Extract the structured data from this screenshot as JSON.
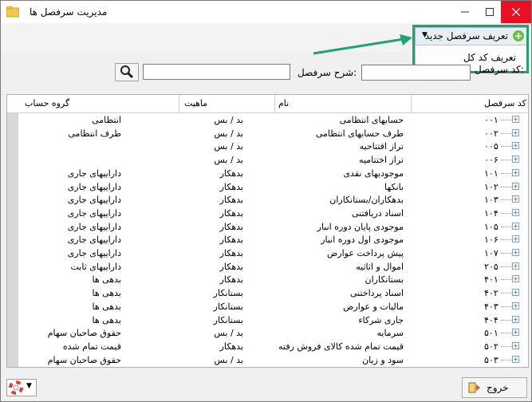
{
  "window": {
    "title": "مدیریت سرفصل ها"
  },
  "toolbar": {
    "new_header_label": "تعریف سرفصل جدید",
    "menu_item_label": "تعریف کد کل"
  },
  "filter": {
    "code_label": "کد سرفصل:",
    "desc_label": "شرح سرفصل:",
    "code_value": "",
    "desc_value": ""
  },
  "table": {
    "columns": {
      "code": "کد سرفصل",
      "name": "نام",
      "nature": "ماهیت",
      "group": "گروه حساب"
    },
    "rows": [
      {
        "code": "۰۰۱",
        "name": "حسابهای انتظامی",
        "nature": "بد / بس",
        "group": "انتظامی"
      },
      {
        "code": "۰۰۲",
        "name": "طرف حسابهای انتظامی",
        "nature": "بد / بس",
        "group": "طرف انتظامی"
      },
      {
        "code": "۰۰۵",
        "name": "تراز افتتاحیه",
        "nature": "بد / بس",
        "group": ""
      },
      {
        "code": "۰۰۶",
        "name": "تراز اختتامیه",
        "nature": "بد / بس",
        "group": ""
      },
      {
        "code": "۱۰۱",
        "name": "موجودیهای نقدی",
        "nature": "بدهکار",
        "group": "داراییهای جاری"
      },
      {
        "code": "۱۰۲",
        "name": "بانکها",
        "nature": "بدهکار",
        "group": "داراییهای جاری"
      },
      {
        "code": "۱۰۳",
        "name": "بدهکاران/بستانکاران",
        "nature": "بدهکار",
        "group": "داراییهای جاری"
      },
      {
        "code": "۱۰۴",
        "name": "اسناد دریافتنی",
        "nature": "بدهکار",
        "group": "داراییهای جاری"
      },
      {
        "code": "۱۰۵",
        "name": "موجودی پایان دوره انبار",
        "nature": "بدهکار",
        "group": "داراییهای جاری"
      },
      {
        "code": "۱۰۶",
        "name": "موجودی اول دوره انبار",
        "nature": "بدهکار",
        "group": "داراییهای جاری"
      },
      {
        "code": "۱۰۷",
        "name": "پیش پرداخت عوارض",
        "nature": "بدهکار",
        "group": "داراییهای جاری"
      },
      {
        "code": "۲۰۵",
        "name": "اموال و اثاثیه",
        "nature": "بدهکار",
        "group": "داراییهای ثابت"
      },
      {
        "code": "۴۰۱",
        "name": "بستانکاران",
        "nature": "بدهکار",
        "group": "بدهی ها"
      },
      {
        "code": "۴۰۲",
        "name": "اسناد پرداختنی",
        "nature": "بستانکار",
        "group": "بدهی ها"
      },
      {
        "code": "۴۰۳",
        "name": "مالیات و عوارض",
        "nature": "بستانکار",
        "group": "بدهی ها"
      },
      {
        "code": "۴۰۴",
        "name": "جاری شرکاء",
        "nature": "بستانکار",
        "group": "بدهی ها"
      },
      {
        "code": "۵۰۱",
        "name": "سرمایه",
        "nature": "بد / بس",
        "group": "حقوق صاحبان سهام"
      },
      {
        "code": "۵۰۲",
        "name": "قیمت تمام شده کالای فروش رفته",
        "nature": "بدهکار",
        "group": "قیمت تمام شده"
      },
      {
        "code": "۵۰۳",
        "name": "سود و زیان",
        "nature": "بد / بس",
        "group": "حقوق صاحبان سهام"
      }
    ]
  },
  "footer": {
    "exit_label": "خروج"
  },
  "colors": {
    "highlight": "#22a36b",
    "close_button": "#e81123",
    "add_icon": "#6cbd45"
  }
}
